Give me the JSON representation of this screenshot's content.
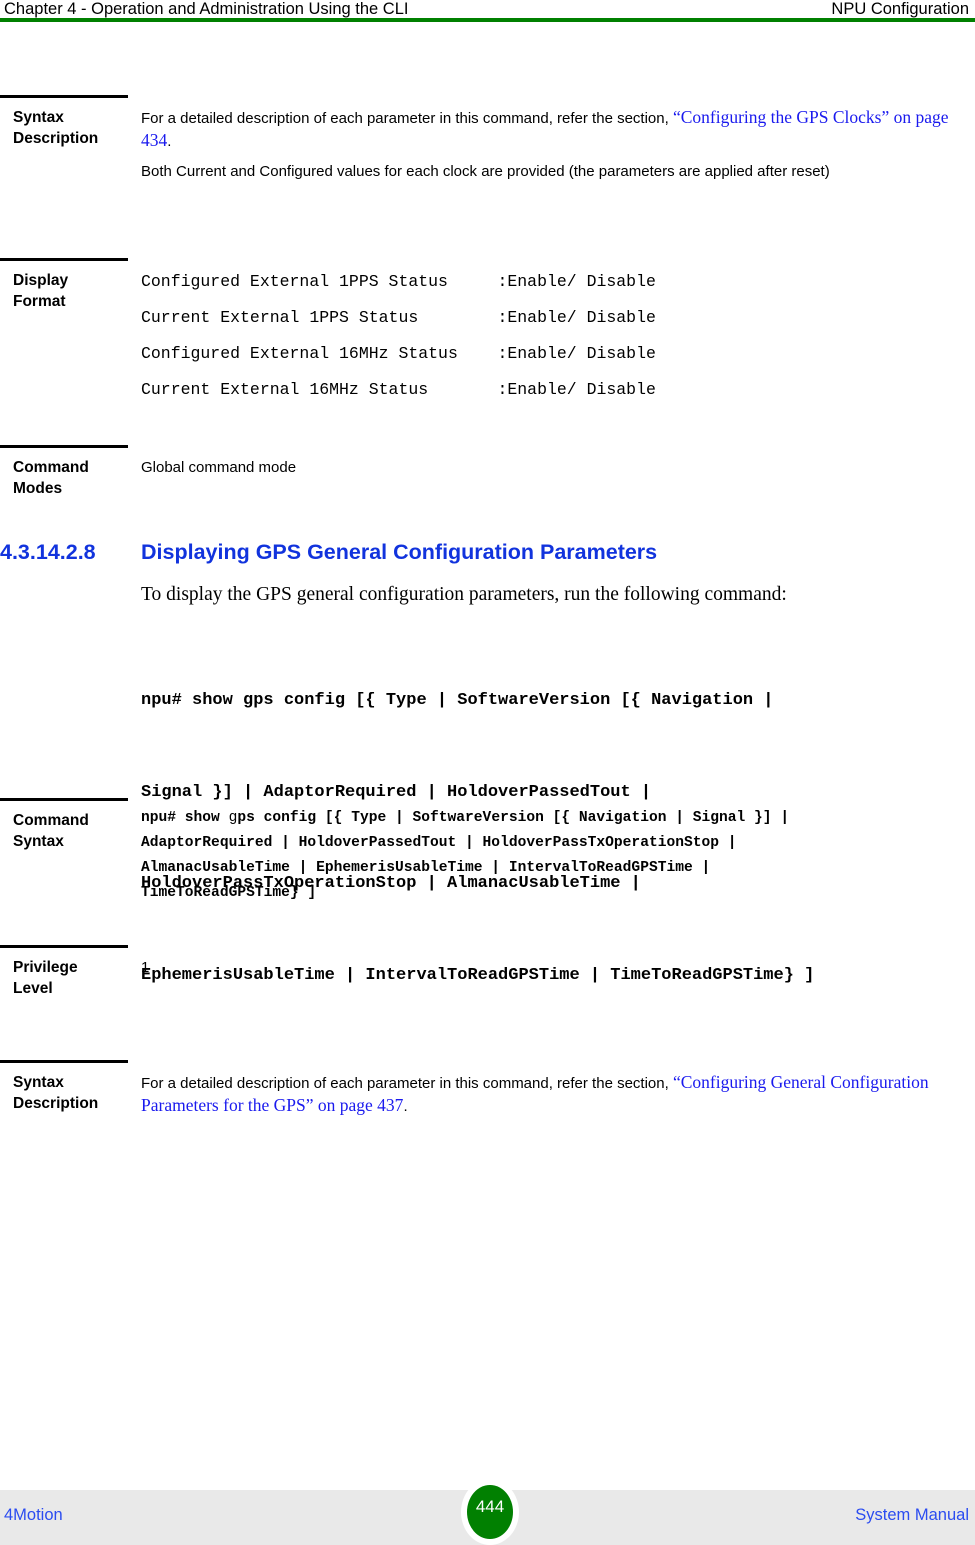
{
  "header": {
    "left": "Chapter 4 - Operation and Administration Using the CLI",
    "right": "NPU Configuration",
    "rule_color": "#008000"
  },
  "blocks": {
    "syntax_description_1": {
      "label_line1": "Syntax",
      "label_line2": "Description",
      "para1_prefix": "For a detailed description of each parameter in this command, refer the section, ",
      "para1_link": "“Configuring the GPS Clocks” on page 434",
      "para1_suffix": ".",
      "para2": "Both Current and Configured values for each clock are provided (the parameters are applied after reset)"
    },
    "display_format": {
      "label_line1": "Display",
      "label_line2": "Format",
      "lines": [
        "Configured External 1PPS Status     :Enable/ Disable",
        "Current External 1PPS Status        :Enable/ Disable",
        "Configured External 16MHz Status    :Enable/ Disable",
        "Current External 16MHz Status       :Enable/ Disable"
      ]
    },
    "command_modes": {
      "label_line1": "Command",
      "label_line2": "Modes",
      "value": "Global command mode"
    },
    "section": {
      "number": "4.3.14.2.8",
      "title": "Displaying GPS General Configuration Parameters",
      "color": "#1133dd"
    },
    "intro": "To display the GPS general configuration parameters, run the following command:",
    "command_block": [
      "npu# show gps config [{ Type | SoftwareVersion [{ Navigation |",
      "Signal }] | AdaptorRequired | HoldoverPassedTout |",
      "HoldoverPassTxOperationStop | AlmanacUsableTime |",
      "EphemerisUsableTime | IntervalToReadGPSTime | TimeToReadGPSTime} ]"
    ],
    "command_syntax": {
      "label_line1": "Command",
      "label_line2": "Syntax",
      "text_before_g": "npu# show ",
      "thin_g": "g",
      "text_after_g": "ps config [{ Type | SoftwareVersion [{ Navigation | Signal }] |\nAdaptorRequired | HoldoverPassedTout | HoldoverPassTxOperationStop |\nAlmanacUsableTime | EphemerisUsableTime | IntervalToReadGPSTime |\nTimeToReadGPSTime} ]"
    },
    "privilege_level": {
      "label_line1": "Privilege",
      "label_line2": "Level",
      "value": "1"
    },
    "syntax_description_2": {
      "label_line1": "Syntax",
      "label_line2": "Description",
      "para1_prefix": "For a detailed description of each parameter in this command, refer the section, ",
      "para1_link": "“Configuring General Configuration Parameters for the GPS” on page 437",
      "para1_suffix": "."
    }
  },
  "footer": {
    "left": "4Motion",
    "page_number": "444",
    "right": "System Manual",
    "band_color": "#e9e9e9",
    "badge_color": "#018001",
    "link_color": "#2b4cf0"
  }
}
